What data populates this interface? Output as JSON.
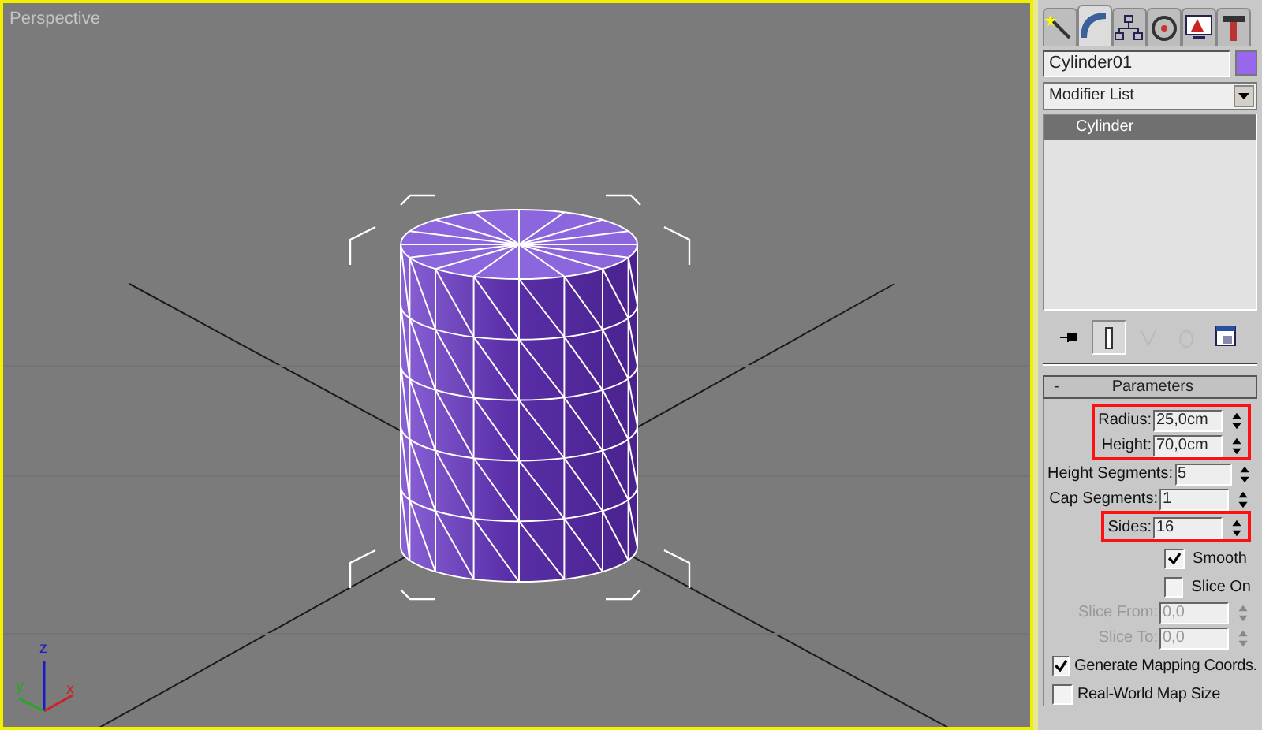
{
  "viewport": {
    "label": "Perspective"
  },
  "axis_gizmo": [
    {
      "label": "z",
      "color": "#1a1acc"
    },
    {
      "label": "y",
      "color": "#22aa22"
    },
    {
      "label": "x",
      "color": "#cc2222"
    }
  ],
  "command_tabs": [
    {
      "kind": "create",
      "selected": false
    },
    {
      "kind": "modify",
      "selected": true
    },
    {
      "kind": "hierarchy",
      "selected": false
    },
    {
      "kind": "motion",
      "selected": false
    },
    {
      "kind": "display",
      "selected": false
    },
    {
      "kind": "utilities",
      "selected": false
    }
  ],
  "object": {
    "name": "Cylinder01",
    "color": "#9966ee"
  },
  "modifier_list": {
    "value": "Modifier List"
  },
  "modifier_stack": [
    {
      "label": "Cylinder",
      "selected": true
    }
  ],
  "stack_tools": [
    {
      "kind": "pin",
      "disabled": false,
      "selected": false
    },
    {
      "kind": "show-end",
      "disabled": false,
      "selected": true
    },
    {
      "kind": "unique",
      "disabled": true,
      "selected": false
    },
    {
      "kind": "remove",
      "disabled": true,
      "selected": false
    },
    {
      "kind": "configure",
      "disabled": false,
      "selected": false
    }
  ],
  "rollout": {
    "sign": "-",
    "title": "Parameters"
  },
  "parameters": [
    {
      "kind": "spinner",
      "label": "Radius:",
      "value": "25,0cm",
      "highlighted": true,
      "disabled": false
    },
    {
      "kind": "spinner",
      "label": "Height:",
      "value": "70,0cm",
      "highlighted": true,
      "disabled": false
    },
    {
      "kind": "spinner",
      "label": "Height Segments:",
      "value": "5",
      "highlighted": false,
      "disabled": false
    },
    {
      "kind": "spinner",
      "label": "Cap Segments:",
      "value": "1",
      "highlighted": false,
      "disabled": false
    },
    {
      "kind": "spinner",
      "label": "Sides:",
      "value": "16",
      "highlighted": true,
      "disabled": false
    },
    {
      "kind": "checkbox",
      "label": "Smooth",
      "checked": true,
      "disabled": false
    },
    {
      "kind": "checkbox",
      "label": "Slice On",
      "checked": false,
      "disabled": false
    },
    {
      "kind": "spinner",
      "label": "Slice From:",
      "value": "0,0",
      "highlighted": false,
      "disabled": true
    },
    {
      "kind": "spinner",
      "label": "Slice To:",
      "value": "0,0",
      "highlighted": false,
      "disabled": true
    },
    {
      "kind": "wide-checkbox",
      "label": "Generate Mapping Coords.",
      "checked": true,
      "disabled": false
    },
    {
      "kind": "wide-checkbox",
      "label": "Real-World Map Size",
      "checked": false,
      "disabled": false
    }
  ]
}
